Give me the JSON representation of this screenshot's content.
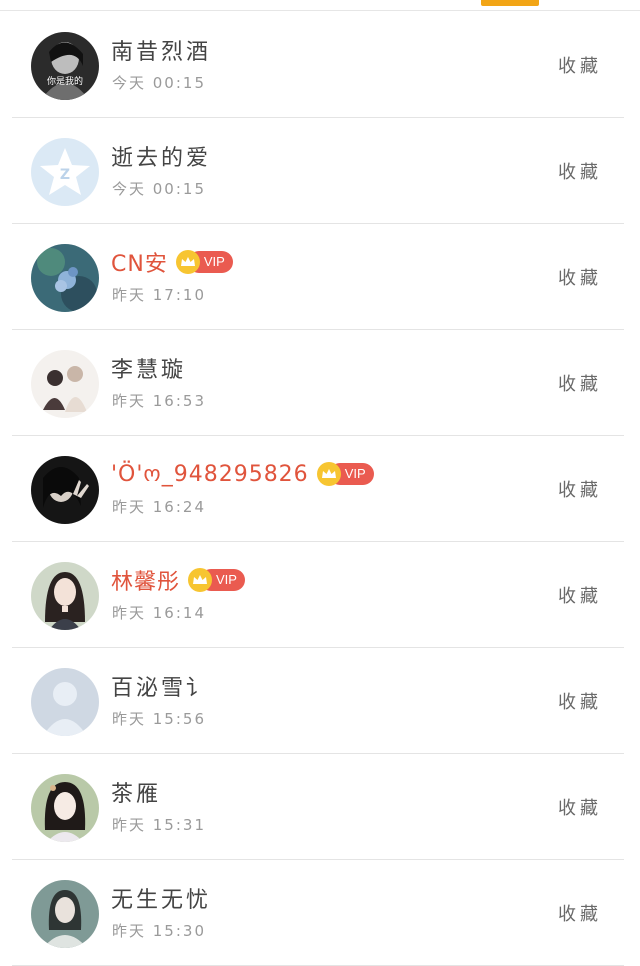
{
  "header": {
    "active_tab_color": "#f2a516"
  },
  "colors": {
    "vip_name": "#e0543c",
    "vip_badge": "#ea5b50",
    "crown": "#f7c531"
  },
  "contacts": [
    {
      "name": "南昔烈酒",
      "time": "今天 00:15",
      "action": "收藏",
      "vip": false,
      "avatar_text": "你是我的",
      "avatar_icon": "dark-portrait-avatar"
    },
    {
      "name": "逝去的爱",
      "time": "今天 00:15",
      "action": "收藏",
      "vip": false,
      "avatar_icon": "qzone-star-avatar"
    },
    {
      "name": "CN安",
      "time": "昨天 17:10",
      "action": "收藏",
      "vip": true,
      "vip_label": "VIP",
      "avatar_icon": "blue-flower-avatar"
    },
    {
      "name": "李慧璇",
      "time": "昨天 16:53",
      "action": "收藏",
      "vip": false,
      "avatar_icon": "couple-illustration-avatar"
    },
    {
      "name": "'Ö'ო_948295826",
      "time": "昨天 16:24",
      "action": "收藏",
      "vip": true,
      "vip_label": "VIP",
      "avatar_icon": "dark-selfie-avatar"
    },
    {
      "name": "林馨彤",
      "time": "昨天 16:14",
      "action": "收藏",
      "vip": true,
      "vip_label": "VIP",
      "avatar_icon": "girl-portrait-avatar"
    },
    {
      "name": "百泌雪讠",
      "time": "昨天 15:56",
      "action": "收藏",
      "vip": false,
      "avatar_icon": "default-user-avatar"
    },
    {
      "name": "茶雁",
      "time": "昨天 15:31",
      "action": "收藏",
      "vip": false,
      "avatar_icon": "costume-girl-avatar"
    },
    {
      "name": "无生无忧",
      "time": "昨天 15:30",
      "action": "收藏",
      "vip": false,
      "avatar_icon": "ancient-costume-avatar"
    }
  ]
}
